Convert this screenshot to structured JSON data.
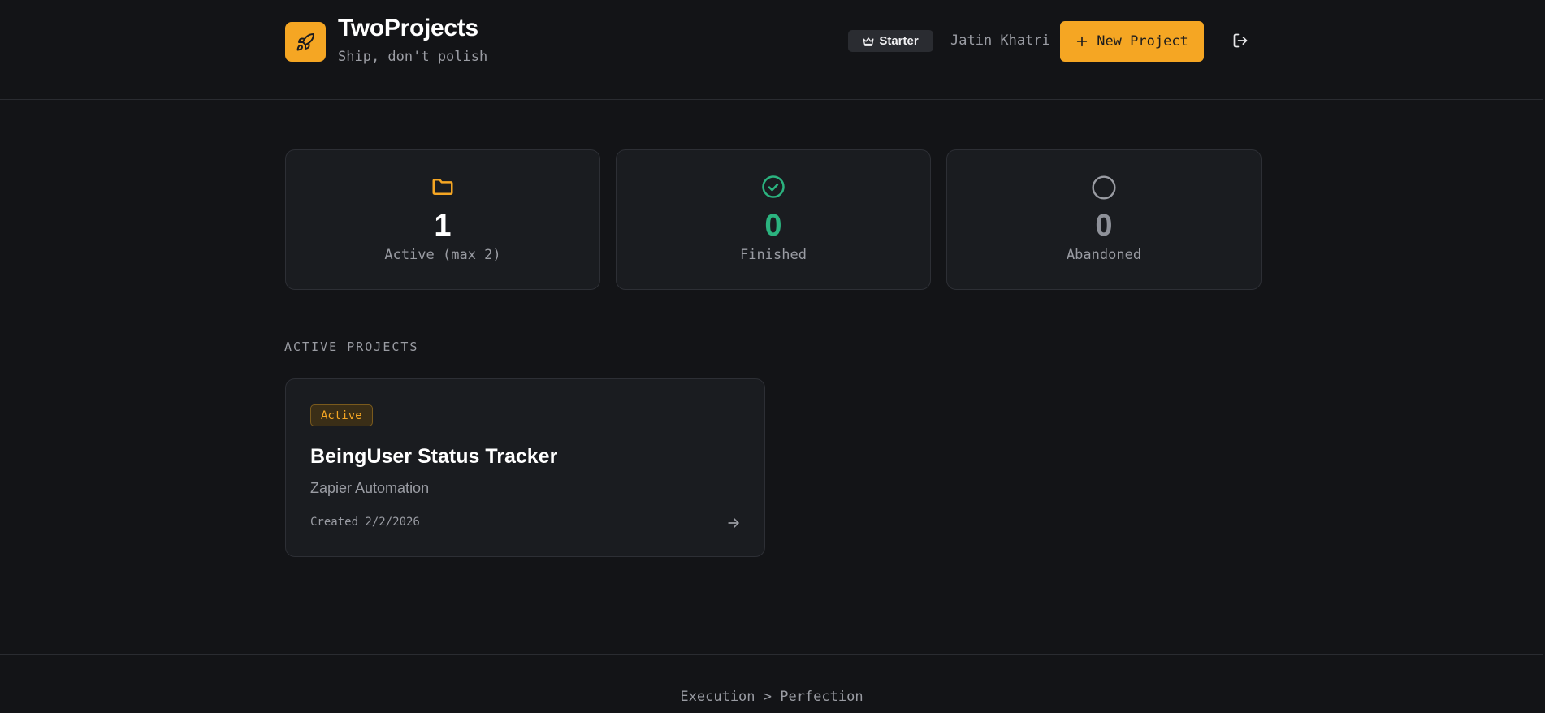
{
  "header": {
    "app_title": "TwoProjects",
    "tagline": "Ship, don't polish",
    "logo_icon": "rocket-icon",
    "plan_badge": "Starter",
    "plan_icon": "crown-icon",
    "user_name": "Jatin Khatri",
    "new_project_label": "New Project",
    "new_project_icon": "plus-icon",
    "logout_icon": "logout-icon"
  },
  "stats": [
    {
      "value": "1",
      "label": "Active (max 2)",
      "icon": "folder-icon",
      "color": "#f5a623",
      "value_color": "#ffffff"
    },
    {
      "value": "0",
      "label": "Finished",
      "icon": "check-circle-icon",
      "color": "#2bb37f",
      "value_color": "#2bb37f"
    },
    {
      "value": "0",
      "label": "Abandoned",
      "icon": "circle-icon",
      "color": "#9a9ca3",
      "value_color": "#8e9199"
    }
  ],
  "active_projects": {
    "heading": "ACTIVE PROJECTS",
    "items": [
      {
        "status": "Active",
        "name": "BeingUser Status Tracker",
        "category": "Zapier Automation",
        "created": "Created 2/2/2026"
      }
    ]
  },
  "footer": {
    "text": "Execution > Perfection"
  },
  "colors": {
    "accent": "#f5a623",
    "background": "#131417",
    "card": "#1a1c20",
    "success": "#2bb37f",
    "muted": "#9a9ca3"
  }
}
